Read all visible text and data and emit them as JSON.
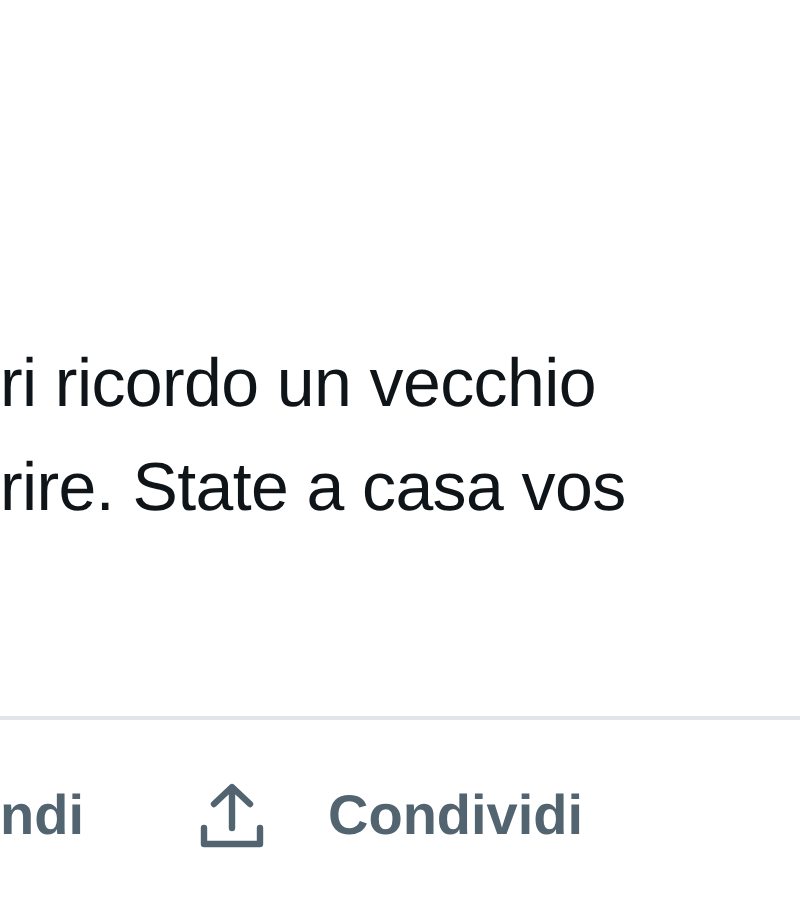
{
  "post": {
    "lines": [
      "ri ricordo un vecchio",
      "rire. State a casa vos"
    ]
  },
  "actions": [
    {
      "kind": "text",
      "label": "ndi"
    },
    {
      "kind": "share",
      "label": "Condividi"
    }
  ]
}
